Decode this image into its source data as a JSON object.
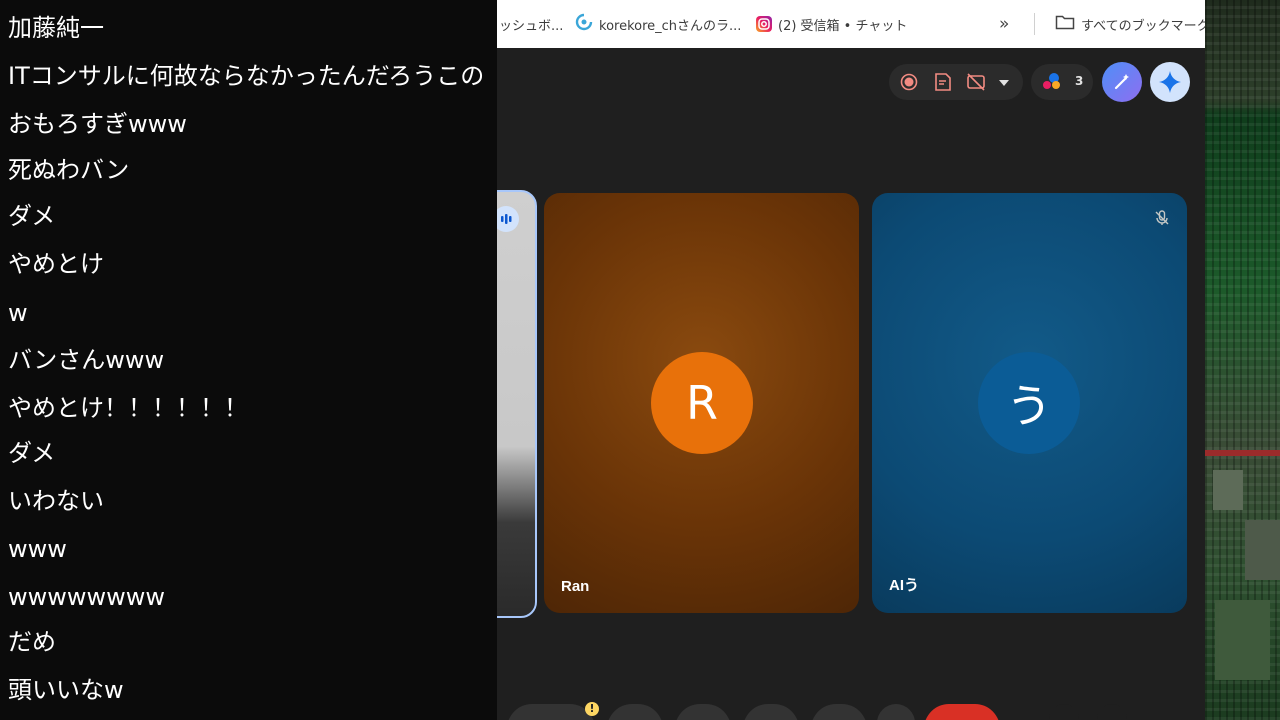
{
  "chat": {
    "messages": [
      "加藤純一",
      "ITコンサルに何故ならなかったんだろうこの",
      "おもろすぎwww",
      "死ぬわバン",
      "ダメ",
      "やめとけ",
      "w",
      "バンさんwww",
      "やめとけ！！！！！！",
      "ダメ",
      "いわない",
      "www",
      "wwwwwwww",
      "だめ",
      "頭いいなw"
    ]
  },
  "bookmarks": {
    "items": [
      {
        "label": "ッシュボ...",
        "icon": "dashboard-icon"
      },
      {
        "label": "korekore_chさんのラ...",
        "icon": "korekore-icon"
      },
      {
        "label": "(2) 受信箱 • チャット",
        "icon": "instagram-icon"
      }
    ],
    "overflow_label": "»",
    "all_bookmarks_label": "すべてのブックマーク"
  },
  "meet": {
    "participants_count": "3",
    "tiles": [
      {
        "name": "Ran",
        "initial": "R",
        "color": "#e8710a"
      },
      {
        "name": "AIう",
        "initial": "う",
        "color": "#0b5c96"
      }
    ]
  },
  "colors": {
    "chat_bg": "#0b0b0b",
    "meet_bg": "#1f1f1f",
    "end_call": "#d93025",
    "accent_blue": "#8ab4f8"
  }
}
